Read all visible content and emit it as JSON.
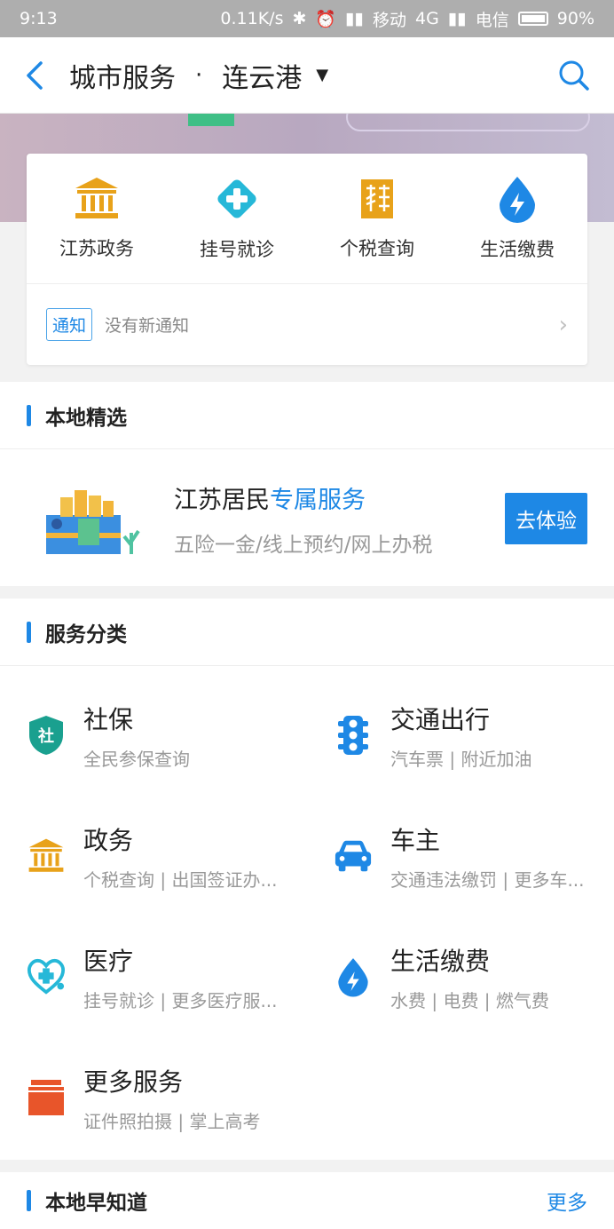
{
  "status_bar": {
    "time": "9:13",
    "speed": "0.11K/s",
    "carrier1": "移动",
    "network": "4G",
    "carrier2": "电信",
    "battery": "90%"
  },
  "nav": {
    "title": "城市服务",
    "separator": "·",
    "city": "连云港",
    "caret": "▼"
  },
  "quick_services": [
    {
      "label": "江苏政务",
      "icon": "government-building-icon",
      "color": "#e8a21a"
    },
    {
      "label": "挂号就诊",
      "icon": "medical-cross-icon",
      "color": "#26b8d8"
    },
    {
      "label": "个税查询",
      "icon": "tax-icon",
      "color": "#e8a21a"
    },
    {
      "label": "生活缴费",
      "icon": "utility-bolt-icon",
      "color": "#1e88e5"
    }
  ],
  "notice": {
    "tag": "通知",
    "text": "没有新通知"
  },
  "local_picks": {
    "title": "本地精选",
    "promo_title_prefix": "江苏居民",
    "promo_title_highlight": "专属服务",
    "promo_subtitle": "五险一金/线上预约/网上办税",
    "button": "去体验"
  },
  "categories": {
    "title": "服务分类",
    "items": [
      {
        "title": "社保",
        "subtitle": "全民参保查询",
        "icon": "social-security-shield-icon",
        "color": "#1aa08f"
      },
      {
        "title": "交通出行",
        "subtitle": "汽车票 | 附近加油",
        "icon": "traffic-light-icon",
        "color": "#1e88e5"
      },
      {
        "title": "政务",
        "subtitle": "个税查询 | 出国签证办...",
        "icon": "government-building-icon",
        "color": "#e8a21a"
      },
      {
        "title": "车主",
        "subtitle": "交通违法缴罚 | 更多车...",
        "icon": "car-icon",
        "color": "#1e88e5"
      },
      {
        "title": "医疗",
        "subtitle": "挂号就诊 | 更多医疗服...",
        "icon": "stethoscope-icon",
        "color": "#26b8d8"
      },
      {
        "title": "生活缴费",
        "subtitle": "水费 | 电费 | 燃气费",
        "icon": "utility-bolt-icon",
        "color": "#1e88e5"
      },
      {
        "title": "更多服务",
        "subtitle": "证件照拍摄 | 掌上高考",
        "icon": "box-icon",
        "color": "#e8552a"
      }
    ]
  },
  "local_news": {
    "title": "本地早知道",
    "more": "更多"
  }
}
